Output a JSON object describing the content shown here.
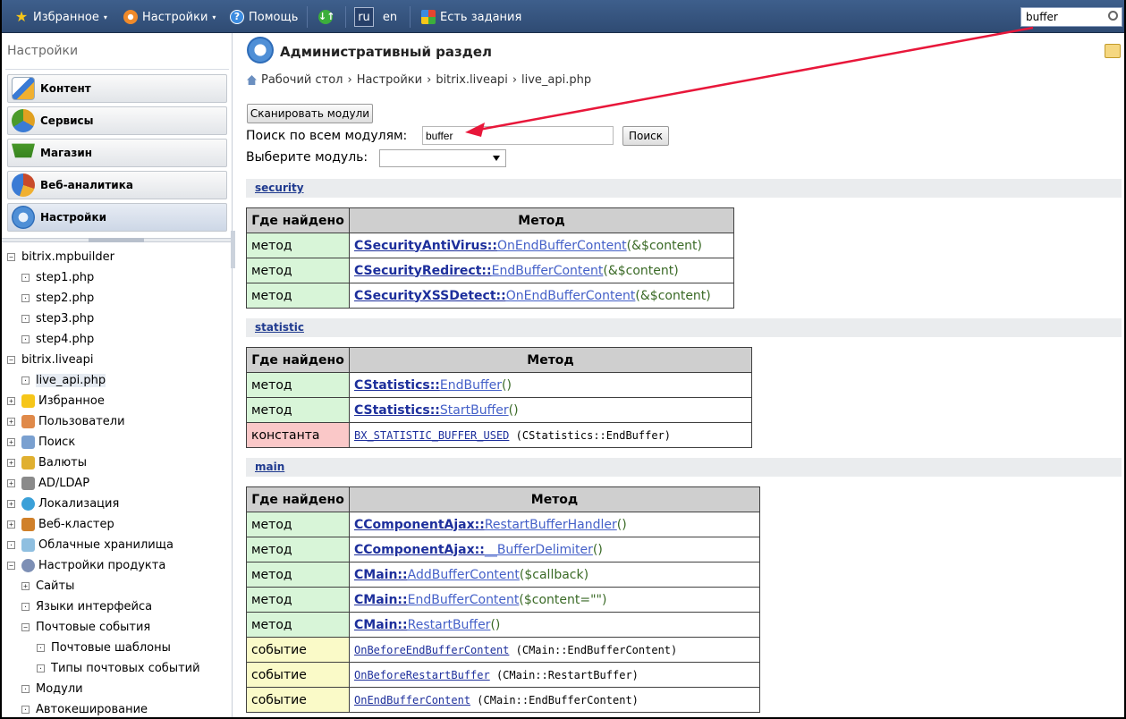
{
  "topbar": {
    "favorites": "Избранное",
    "settings": "Настройки",
    "help": "Помощь",
    "lang_ru": "ru",
    "lang_en": "en",
    "tasks": "Есть задания",
    "search_value": "buffer"
  },
  "left": {
    "title": "Настройки",
    "menu": [
      {
        "label": "Контент",
        "icon": "content-icon",
        "color": "#3a7bd5"
      },
      {
        "label": "Сервисы",
        "icon": "services-icon",
        "color": "#e0a020"
      },
      {
        "label": "Магазин",
        "icon": "shop-cart-icon",
        "color": "#4a9a2a"
      },
      {
        "label": "Веб-аналитика",
        "icon": "analytics-icon",
        "color": "#c84a2a"
      },
      {
        "label": "Настройки",
        "icon": "settings-gear-icon",
        "color": "#3a7bd5"
      }
    ],
    "tree": [
      {
        "label": "bitrix.mpbuilder",
        "toggle": "−"
      },
      {
        "label": "step1.php",
        "toggle": "·"
      },
      {
        "label": "step2.php",
        "toggle": "·"
      },
      {
        "label": "step3.php",
        "toggle": "·"
      },
      {
        "label": "step4.php",
        "toggle": "·"
      },
      {
        "label": "bitrix.liveapi",
        "toggle": "−"
      },
      {
        "label": "live_api.php",
        "toggle": "·"
      },
      {
        "label": "Избранное",
        "toggle": "+"
      },
      {
        "label": "Пользователи",
        "toggle": "+"
      },
      {
        "label": "Поиск",
        "toggle": "+"
      },
      {
        "label": "Валюты",
        "toggle": "+"
      },
      {
        "label": "AD/LDAP",
        "toggle": "+"
      },
      {
        "label": "Локализация",
        "toggle": "+"
      },
      {
        "label": "Веб-кластер",
        "toggle": "+"
      },
      {
        "label": "Облачные хранилища",
        "toggle": "·"
      },
      {
        "label": "Настройки продукта",
        "toggle": "−"
      },
      {
        "label": "Сайты",
        "toggle": "+"
      },
      {
        "label": "Языки интерфейса",
        "toggle": "·"
      },
      {
        "label": "Почтовые события",
        "toggle": "−"
      },
      {
        "label": "Почтовые шаблоны",
        "toggle": "·"
      },
      {
        "label": "Типы почтовых событий",
        "toggle": "·"
      },
      {
        "label": "Модули",
        "toggle": "·"
      },
      {
        "label": "Автокеширование",
        "toggle": "·"
      }
    ]
  },
  "main": {
    "title": "Административный раздел",
    "breadcrumb": [
      "Рабочий стол",
      "Настройки",
      "bitrix.liveapi",
      "live_api.php"
    ],
    "breadcrumb_sep": "›",
    "scan_button": "Сканировать модули",
    "search_label": "Поиск по всем модулям:",
    "search_value": "buffer",
    "find_button": "Поиск",
    "module_label": "Выберите модуль:",
    "col_found": "Где найдено",
    "col_method": "Метод",
    "sections": [
      {
        "name": "security",
        "rows": [
          {
            "kind": "метод",
            "cls": "CSecurityAntiVirus::",
            "method": "OnEndBufferContent",
            "args": "(&$content)"
          },
          {
            "kind": "метод",
            "cls": "CSecurityRedirect::",
            "method": "EndBufferContent",
            "args": "(&$content)"
          },
          {
            "kind": "метод",
            "cls": "CSecurityXSSDetect::",
            "method": "OnEndBufferContent",
            "args": "(&$content)"
          }
        ]
      },
      {
        "name": "statistic",
        "rows": [
          {
            "kind": "метод",
            "cls": "CStatistics::",
            "method": "EndBuffer",
            "args": "()"
          },
          {
            "kind": "метод",
            "cls": "CStatistics::",
            "method": "StartBuffer",
            "args": "()"
          },
          {
            "kind": "константа",
            "const": "BX_STATISTIC_BUFFER_USED",
            "ref": "(CStatistics::EndBuffer)"
          }
        ]
      },
      {
        "name": "main",
        "rows": [
          {
            "kind": "метод",
            "cls": "CComponentAjax::",
            "method": "RestartBufferHandler",
            "args": "()"
          },
          {
            "kind": "метод",
            "cls": "CComponentAjax::",
            "method": "__BufferDelimiter",
            "args": "()"
          },
          {
            "kind": "метод",
            "cls": "CMain::",
            "method": "AddBufferContent",
            "args": "($callback)"
          },
          {
            "kind": "метод",
            "cls": "CMain::",
            "method": "EndBufferContent",
            "args": "($content=\"\")"
          },
          {
            "kind": "метод",
            "cls": "CMain::",
            "method": "RestartBuffer",
            "args": "()"
          },
          {
            "kind": "событие",
            "event": "OnBeforeEndBufferContent",
            "ref": "(CMain::EndBufferContent)"
          },
          {
            "kind": "событие",
            "event": "OnBeforeRestartBuffer",
            "ref": "(CMain::RestartBuffer)"
          },
          {
            "kind": "событие",
            "event": "OnEndBufferContent",
            "ref": "(CMain::EndBufferContent)"
          }
        ]
      }
    ]
  },
  "colors": {
    "topbar": "#34507a",
    "method_bg": "#d8f5d8",
    "const_bg": "#fac8c8",
    "event_bg": "#fafac8",
    "annotation_arrow": "#e8173a"
  }
}
